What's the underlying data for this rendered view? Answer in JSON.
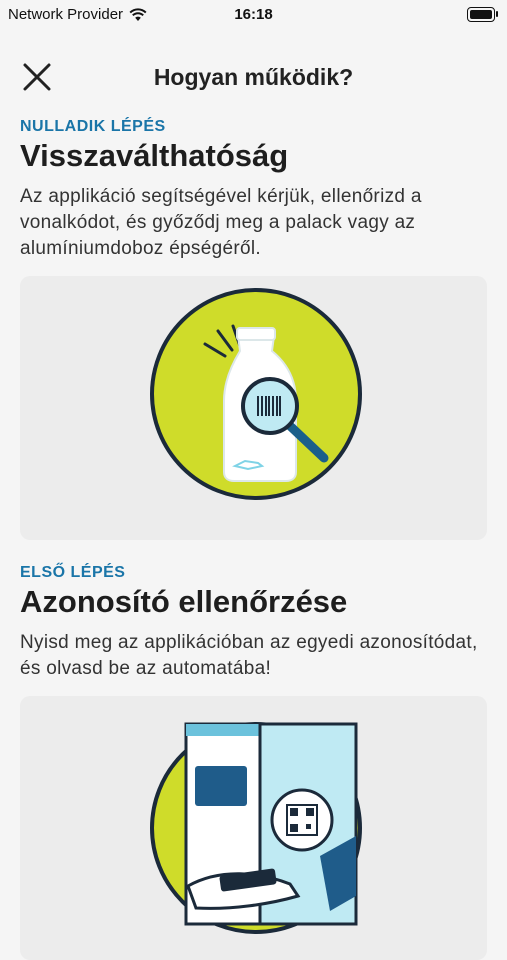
{
  "status_bar": {
    "carrier": "Network Provider",
    "time": "16:18",
    "wifi_icon": "wifi-icon",
    "battery_icon": "battery-icon"
  },
  "nav": {
    "title": "Hogyan működik?",
    "close_icon": "close-icon"
  },
  "steps": [
    {
      "label": "NULLADIK LÉPÉS",
      "title": "Visszaválthatóság",
      "text": "Az applikáció segítségével kérjük, ellenőrizd a vonalkódot, és győződj meg a palack vagy az alumíniumdoboz épségéről.",
      "illustration": "bottle-barcode-check-illustration"
    },
    {
      "label": "ELSŐ LÉPÉS",
      "title": "Azonosító ellenőrzése",
      "text": "Nyisd meg  az applikációban az egyedi azonosítódat, és olvasd be az automatába!",
      "illustration": "qr-scan-machine-illustration"
    }
  ],
  "colors": {
    "accent_label": "#1a75a8",
    "circle_fill": "#cfdc2a",
    "outline": "#1b2a3a",
    "illustration_bg": "#ececec"
  }
}
